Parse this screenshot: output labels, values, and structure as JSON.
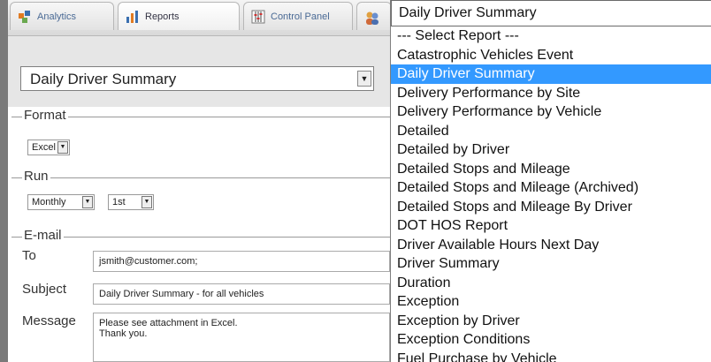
{
  "tabs": [
    {
      "label": "Analytics",
      "icon": "analytics-icon"
    },
    {
      "label": "Reports",
      "icon": "reports-icon"
    },
    {
      "label": "Control Panel",
      "icon": "control-panel-icon"
    },
    {
      "label": "",
      "icon": "users-icon"
    }
  ],
  "report": {
    "selected": "Daily Driver Summary"
  },
  "format": {
    "legend": "Format",
    "value": "Excel"
  },
  "run": {
    "legend": "Run",
    "frequency": "Monthly",
    "day": "1st"
  },
  "email": {
    "legend": "E-mail",
    "to_label": "To",
    "to_value": "jsmith@customer.com;",
    "subject_label": "Subject",
    "subject_value": "Daily Driver Summary - for all vehicles",
    "message_label": "Message",
    "message_value": "Please see attachment in Excel.\nThank you."
  },
  "dropdown": {
    "header": "Daily Driver Summary",
    "items": [
      "--- Select Report ---",
      "Catastrophic Vehicles Event",
      "Daily Driver Summary",
      "Delivery Performance by Site",
      "Delivery Performance by Vehicle",
      "Detailed",
      "Detailed by Driver",
      "Detailed Stops and Mileage",
      "Detailed Stops and Mileage (Archived)",
      "Detailed Stops and Mileage By Driver",
      "DOT HOS Report",
      "Driver Available Hours Next Day",
      "Driver Summary",
      "Duration",
      "Exception",
      "Exception by Driver",
      "Exception Conditions",
      "Fuel Purchase by Vehicle"
    ],
    "selected_index": 2
  },
  "colors": {
    "highlight": "#3399ff",
    "tab_text": "#4a6a95"
  }
}
